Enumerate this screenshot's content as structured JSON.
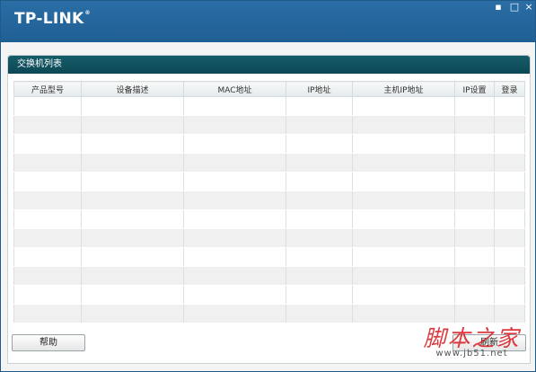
{
  "titlebar": {
    "logo": "TP-LINK",
    "logo_mark": "®",
    "controls": {
      "minimize": "▪",
      "maximize": "□",
      "close": "×"
    }
  },
  "panel": {
    "title": "交换机列表",
    "columns": [
      "产品型号",
      "设备描述",
      "MAC地址",
      "IP地址",
      "主机IP地址",
      "IP设置",
      "登录"
    ],
    "row_count": 12
  },
  "buttons": {
    "help": "帮助",
    "refresh": "刷新"
  },
  "watermark": {
    "main": "脚本之家",
    "sub": "www.jb51.net"
  }
}
